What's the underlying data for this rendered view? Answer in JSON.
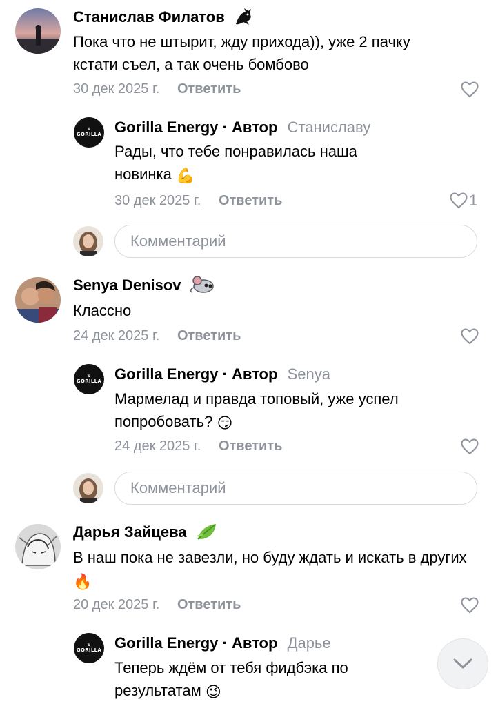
{
  "comment_input_placeholder": "Комментарий",
  "reply_label": "Ответить",
  "author_badge": "· Автор",
  "threads": [
    {
      "author": "Станислав Филатов",
      "author_badge_icon": "dragon-icon",
      "text": "Пока что не штырит, жду прихода)), уже 2 пачку кстати съел, а так очень бомбово",
      "date": "30 дек 2025 г.",
      "reply": {
        "author": "Gorilla Energy",
        "reply_to": "Станиславу",
        "text": "Рады, что тебе понравилась наша новинка",
        "text_emoji": "💪",
        "date": "30 дек 2025 г.",
        "likes": "1"
      }
    },
    {
      "author": "Senya Denisov",
      "author_badge_icon": "mouse-icon",
      "text": "Классно",
      "date": "24 дек 2025 г.",
      "reply": {
        "author": "Gorilla Energy",
        "reply_to": "Senya",
        "text": "Мармелад и правда топовый, уже успел попробовать?",
        "text_emoji": "😏",
        "date": "24 дек 2025 г."
      }
    },
    {
      "author": "Дарья Зайцева",
      "author_badge_icon": "leaf-icon",
      "text": "В наш пока не завезли, но буду ждать и искать в других",
      "text_emoji": "🔥",
      "date": "20 дек 2025 г.",
      "reply": {
        "author": "Gorilla Energy",
        "reply_to": "Дарье",
        "text": "Теперь ждём от тебя фидбэка по результатам",
        "text_emoji": "😉"
      }
    }
  ],
  "brand_logo_text": "GORILLA",
  "colors": {
    "muted": "#8e939b",
    "border": "#d8dadd"
  }
}
